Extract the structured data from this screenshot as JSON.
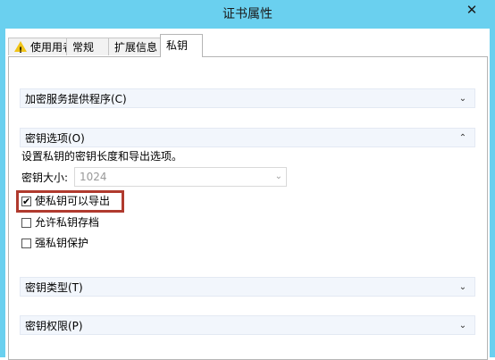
{
  "window": {
    "title": "证书属性",
    "close_label": "✕"
  },
  "tabs": [
    {
      "label": "使用用者",
      "icon": "warning-icon"
    },
    {
      "label": "常规"
    },
    {
      "label": "扩展信息"
    },
    {
      "label": "私钥",
      "active": true
    }
  ],
  "sections": {
    "csp": {
      "label": "加密服务提供程序(C)",
      "expanded": false
    },
    "key_options": {
      "label": "密钥选项(O)",
      "expanded": true,
      "description": "设置私钥的密钥长度和导出选项。",
      "key_size_label": "密钥大小:",
      "key_size_value": "1024",
      "checkboxes": [
        {
          "label": "使私钥可以导出",
          "checked": true
        },
        {
          "label": "允许私钥存档",
          "checked": false
        },
        {
          "label": "强私钥保护",
          "checked": false
        }
      ]
    },
    "key_type": {
      "label": "密钥类型(T)",
      "expanded": false
    },
    "key_permissions": {
      "label": "密钥权限(P)",
      "expanded": false
    }
  },
  "icons": {
    "collapsed": "chevron-down-icon",
    "expanded": "chevron-up-icon"
  },
  "colors": {
    "titlebar": "#6ad0ef",
    "highlight": "#b03a2e",
    "section_bg": "#f2f6fc"
  }
}
